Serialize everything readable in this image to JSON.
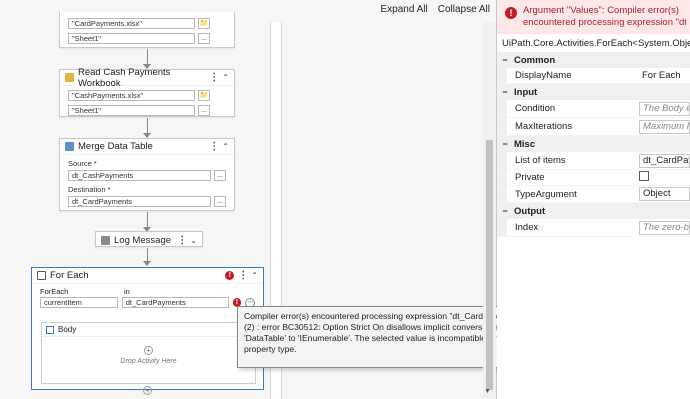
{
  "toolbar": {
    "expand_all": "Expand All",
    "collapse_all": "Collapse All"
  },
  "workflow": {
    "first": {
      "file": "\"CardPayments.xlsx\"",
      "sheet": "\"Sheet1\"",
      "more": "..."
    },
    "read_cash": {
      "title": "Read Cash Payments Workbook",
      "file": "\"CashPayments.xlsx\"",
      "sheet": "\"Sheet1\"",
      "more": "..."
    },
    "merge": {
      "title": "Merge Data Table",
      "source_label": "Source *",
      "source_value": "dt_CashPayments",
      "destination_label": "Destination *",
      "destination_value": "dt_CardPayments",
      "more": "..."
    },
    "log": {
      "title": "Log Message"
    },
    "foreach": {
      "title": "For Each",
      "foreach_label": "ForEach",
      "in_label": "in",
      "item_value": "currentItem",
      "in_value": "dt_CardPayments",
      "error_mark": "!",
      "body_title": "Body",
      "drop_text": "Drop Activity Here"
    }
  },
  "tooltip": {
    "text": "Compiler error(s) encountered processing expression \"dt_CardPayments\". (2) : error BC30512: Option Strict On disallows implicit conversions from 'DataTable' to 'IEnumerable'. The selected value is incompatible with the property type."
  },
  "properties": {
    "error_line1": "Argument \"Values\": Compiler error(s)",
    "error_line2": "encountered processing expression \"dt_C",
    "activity_type": "UiPath.Core.Activities.ForEach<System.Object>",
    "categories": {
      "common": "Common",
      "input": "Input",
      "misc": "Misc",
      "output": "Output"
    },
    "toggle": "−",
    "rows": {
      "display_name": {
        "name": "DisplayName",
        "value": "For Each"
      },
      "condition": {
        "name": "Condition",
        "placeholder": "The Body exe"
      },
      "max_iterations": {
        "name": "MaxIterations",
        "placeholder": "Maximum lo"
      },
      "list_of_items": {
        "name": "List of items",
        "value": "dt_CardPaym"
      },
      "private": {
        "name": "Private"
      },
      "type_argument": {
        "name": "TypeArgument",
        "value": "Object"
      },
      "index": {
        "name": "Index",
        "placeholder": "The zero-base"
      }
    }
  },
  "colors": {
    "selection": "#3b78c7",
    "error": "#c41e25",
    "error_bg": "#fde7e9"
  }
}
